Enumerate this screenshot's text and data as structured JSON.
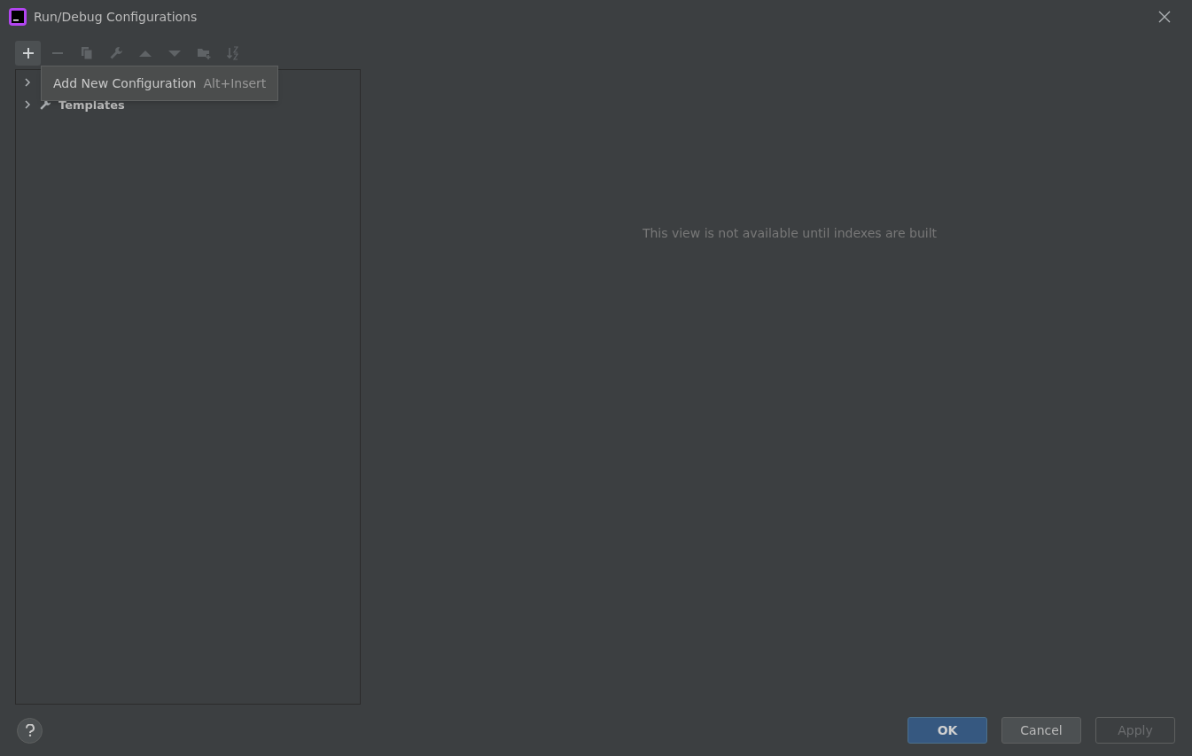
{
  "window": {
    "title": "Run/Debug Configurations"
  },
  "toolbar": [
    {
      "kind": "add",
      "disabled": false,
      "selected": true
    },
    {
      "kind": "remove",
      "disabled": true,
      "selected": false
    },
    {
      "kind": "copy",
      "disabled": true,
      "selected": false
    },
    {
      "kind": "edit",
      "disabled": true,
      "selected": false
    },
    {
      "kind": "up",
      "disabled": true,
      "selected": false
    },
    {
      "kind": "down",
      "disabled": true,
      "selected": false
    },
    {
      "kind": "folder",
      "disabled": true,
      "selected": false
    },
    {
      "kind": "sort",
      "disabled": true,
      "selected": false
    }
  ],
  "tooltip": {
    "text": "Add New Configuration",
    "shortcut": "Alt+Insert"
  },
  "tree": [
    {
      "expanded": false
    },
    {
      "label": "Templates",
      "expanded": false
    }
  ],
  "message": "This view is not available until indexes are built",
  "buttons": [
    {
      "label": "OK",
      "kind": "default",
      "disabled": false
    },
    {
      "label": "Cancel",
      "kind": "normal",
      "disabled": false
    },
    {
      "label": "Apply",
      "kind": "normal",
      "disabled": true
    }
  ]
}
